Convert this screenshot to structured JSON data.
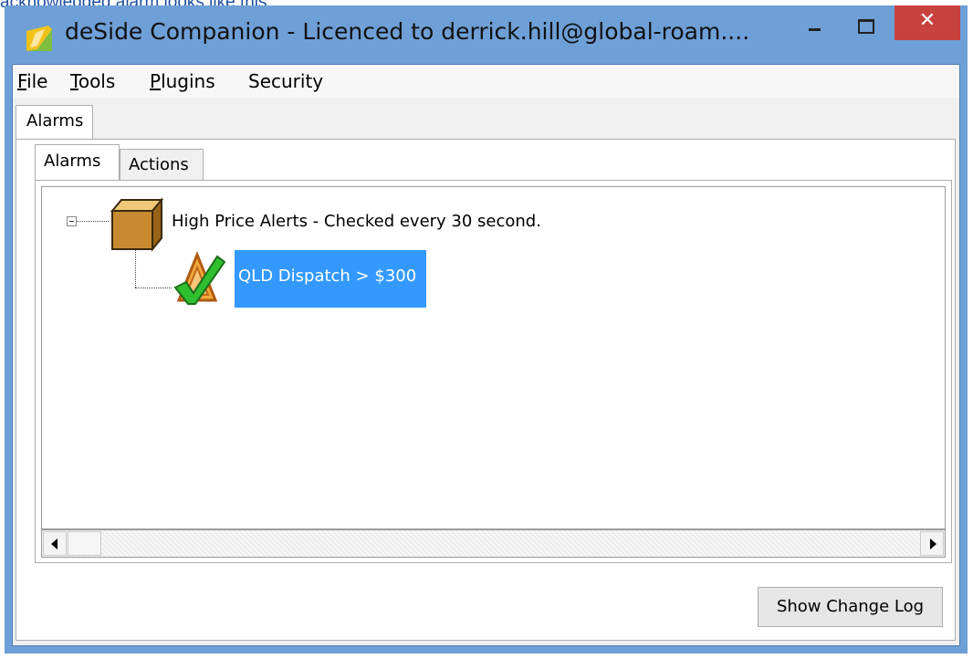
{
  "doc_text": "acknowledged alarm looks like this:",
  "window": {
    "title": "deSide Companion - Licenced to derrick.hill@global-roam....",
    "controls": {
      "minimize": "minimize",
      "maximize": "maximize",
      "close": "✕"
    }
  },
  "menu": {
    "file": {
      "accel": "F",
      "rest": "ile"
    },
    "tools": {
      "accel": "T",
      "rest": "ools"
    },
    "plugins": {
      "accel": "P",
      "rest": "lugins"
    },
    "security": "Security"
  },
  "outer_tab": "Alarms",
  "inner_tabs": [
    "Alarms",
    "Actions"
  ],
  "tree": {
    "group_label": "High Price Alerts - Checked every 30 second.",
    "alarm_label": "QLD Dispatch > $300"
  },
  "buttons": {
    "show_change_log": "Show Change Log"
  },
  "colors": {
    "selection": "#3399ff",
    "close_button": "#c7413d",
    "window_frame": "#6e9fd7",
    "doc_text": "#1f4e9c"
  }
}
